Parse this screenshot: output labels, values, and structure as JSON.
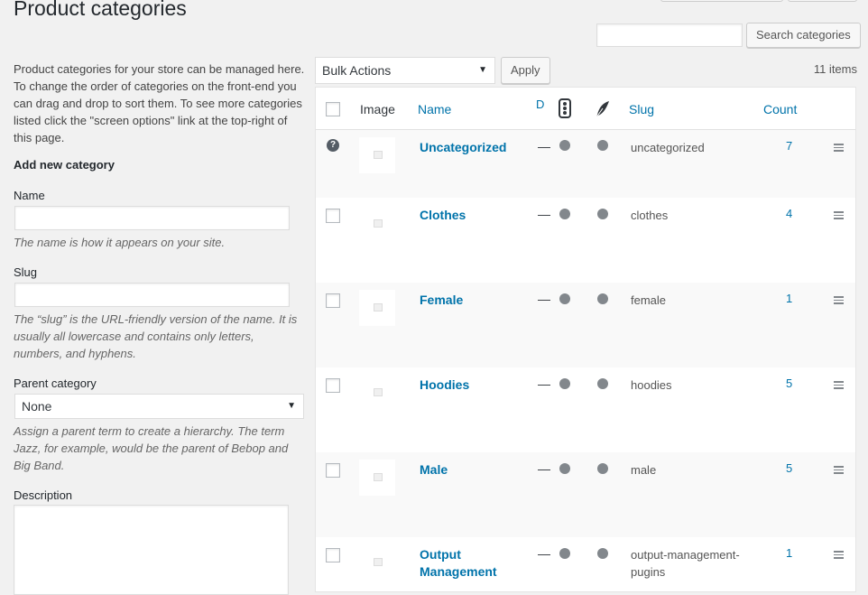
{
  "page": {
    "title": "Product categories"
  },
  "search": {
    "button": "Search categories",
    "value": ""
  },
  "bulk": {
    "select_value": "Bulk Actions",
    "apply": "Apply",
    "items_count": "11 items"
  },
  "form": {
    "intro": "Product categories for your store can be managed here. To change the order of categories on the front-end you can drag and drop to sort them. To see more categories listed click the \"screen options\" link at the top-right of this page.",
    "heading": "Add new category",
    "name_label": "Name",
    "name_help": "The name is how it appears on your site.",
    "slug_label": "Slug",
    "slug_help": "The “slug” is the URL-friendly version of the name. It is usually all lowercase and contains only letters, numbers, and hyphens.",
    "parent_label": "Parent category",
    "parent_value": "None",
    "parent_help": "Assign a parent term to create a hierarchy. The term Jazz, for example, would be the parent of Bebop and Big Band.",
    "description_label": "Description"
  },
  "table": {
    "columns": {
      "image": "Image",
      "name": "Name",
      "description": "D",
      "slug": "Slug",
      "count": "Count"
    },
    "rows": [
      {
        "name": "Uncategorized",
        "dash": "—",
        "slug": "uncategorized",
        "count": "7",
        "help_icon": "?"
      },
      {
        "name": "Clothes",
        "dash": "—",
        "slug": "clothes",
        "count": "4"
      },
      {
        "name": "Female",
        "dash": "—",
        "slug": "female",
        "count": "1"
      },
      {
        "name": "Hoodies",
        "dash": "—",
        "slug": "hoodies",
        "count": "5"
      },
      {
        "name": "Male",
        "dash": "—",
        "slug": "male",
        "count": "5"
      },
      {
        "name": "Output Management",
        "dash": "—",
        "slug": "output-management-pugins",
        "count": "1"
      }
    ]
  },
  "colors": {
    "link": "#0073aa",
    "status_dot": "#82878c",
    "background": "#f1f1f1"
  }
}
